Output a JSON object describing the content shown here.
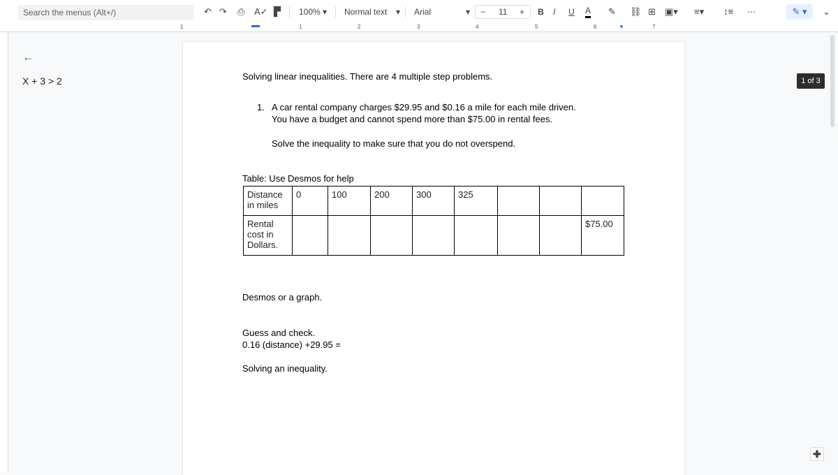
{
  "toolbar": {
    "search_placeholder": "Search the menus (Alt+/)",
    "zoom": "100%",
    "style": "Normal text",
    "font": "Arial",
    "font_size": "11",
    "minus": "−",
    "plus": "+",
    "bold": "B",
    "italic": "I",
    "underline": "U",
    "text_color": "A",
    "more": "⋯"
  },
  "ruler": {
    "marks": [
      "1",
      "1",
      "2",
      "3",
      "4",
      "5",
      "6",
      "7"
    ]
  },
  "outline": {
    "back": "←",
    "heading": "X + 3 > 2"
  },
  "doc": {
    "intro": "Solving linear inequalities. There are 4 multiple step problems.",
    "item_num": "1.",
    "item_line1": "A car rental company charges $29.95 and $0.16 a mile for each mile driven.",
    "item_line2": "You have a budget and cannot spend more than $75.00 in rental fees.",
    "solve": "Solve the inequality to make sure that you do not overspend.",
    "table_caption": "Table: Use Desmos for help",
    "table": [
      [
        "Distance in miles",
        "0",
        "100",
        "200",
        "300",
        "325",
        "",
        "",
        ""
      ],
      [
        "Rental cost in Dollars.",
        "",
        "",
        "",
        "",
        "",
        "",
        "",
        "$75.00"
      ]
    ],
    "desmos": "Desmos or a graph.",
    "guess": "Guess and check.",
    "formula": "0.16 (distance) +29.95 =",
    "solving": "Solving an inequality."
  },
  "page_badge": "1 of 3"
}
